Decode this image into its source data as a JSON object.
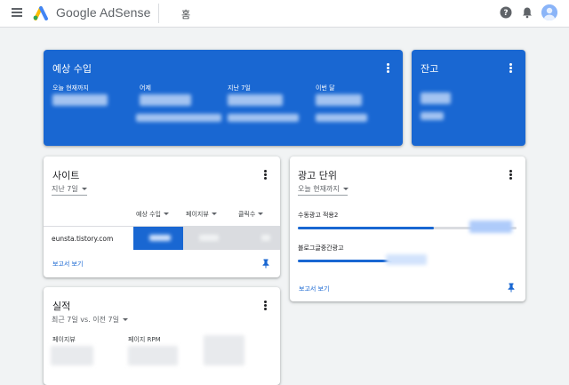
{
  "header": {
    "brand": "Google AdSense",
    "breadcrumb": "홈"
  },
  "earnings": {
    "title": "예상 수입",
    "columns": [
      {
        "label": "오늘 현재까지"
      },
      {
        "label": "어제"
      },
      {
        "label": "지난 7일"
      },
      {
        "label": "이번 달"
      }
    ]
  },
  "balance": {
    "title": "잔고"
  },
  "sites": {
    "title": "사이트",
    "range": "지난 7일",
    "columns": [
      "예상 수입",
      "페이지뷰",
      "클릭수"
    ],
    "rows": [
      {
        "site": "eunsta.tistory.com"
      }
    ],
    "report_link": "보고서 보기"
  },
  "ad_units": {
    "title": "광고 단위",
    "range": "오늘 현재까지",
    "units": [
      {
        "name": "수동광고 적용2",
        "fill": 0.62
      },
      {
        "name": "블로그글중간광고",
        "fill": 0.43
      }
    ],
    "report_link": "보고서 보기"
  },
  "performance": {
    "title": "실적",
    "range": "최근 7일 vs. 이전 7일",
    "metrics": [
      "페이지뷰",
      "페이지 RPM"
    ]
  },
  "colors": {
    "accent": "#1967d2",
    "background": "#f1f3f4",
    "track": "#dadce0"
  }
}
